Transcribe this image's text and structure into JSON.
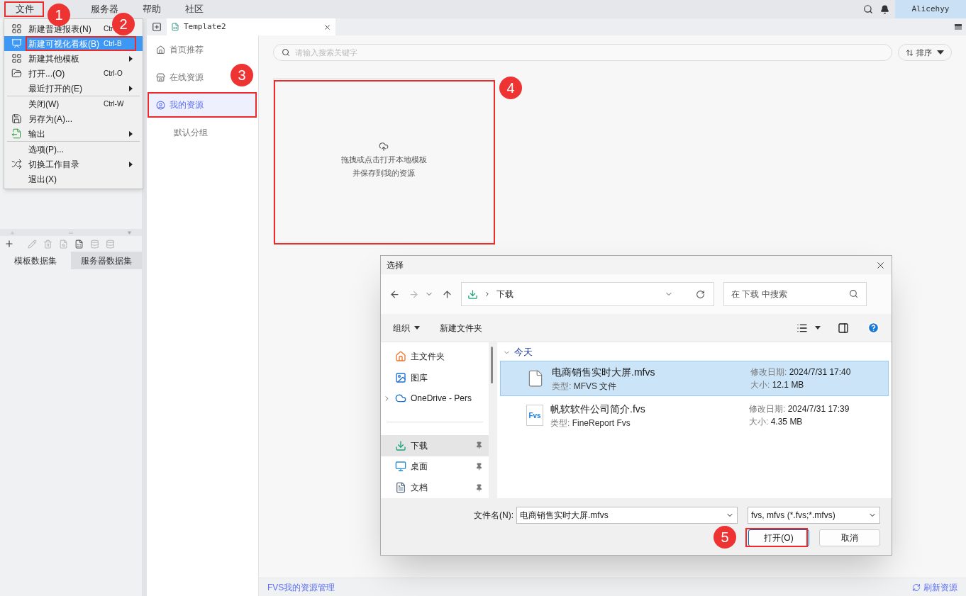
{
  "menubar": {
    "items": [
      {
        "label": "文件"
      },
      {
        "label": "服务器"
      },
      {
        "label": "帮助"
      },
      {
        "label": "社区"
      }
    ],
    "user": "Alicehyy"
  },
  "file_menu": {
    "items": [
      {
        "kind": "item",
        "label": "新建普通报表(N)",
        "shortcut": "Ctr",
        "selected": false,
        "submenu": false
      },
      {
        "kind": "item",
        "label": "新建可视化看板(B)",
        "shortcut": "Ctrl-B",
        "selected": true,
        "submenu": false
      },
      {
        "kind": "item",
        "label": "新建其他模板",
        "selected": false,
        "submenu": true
      },
      {
        "kind": "item",
        "label": "打开...(O)",
        "shortcut": "Ctrl-O",
        "selected": false,
        "submenu": false
      },
      {
        "kind": "item",
        "label": "最近打开的(E)",
        "selected": false,
        "submenu": true
      },
      {
        "kind": "separator"
      },
      {
        "kind": "item",
        "label": "关闭(W)",
        "shortcut": "Ctrl-W",
        "selected": false,
        "submenu": false
      },
      {
        "kind": "item",
        "label": "另存为(A)...",
        "selected": false,
        "submenu": false
      },
      {
        "kind": "item",
        "label": "输出",
        "selected": false,
        "submenu": true
      },
      {
        "kind": "separator"
      },
      {
        "kind": "item",
        "label": "选项(P)...",
        "selected": false,
        "submenu": false
      },
      {
        "kind": "item",
        "label": "切换工作目录",
        "selected": false,
        "submenu": true
      },
      {
        "kind": "item",
        "label": "退出(X)",
        "selected": false,
        "submenu": false
      }
    ]
  },
  "dataset_panel": {
    "tabs": [
      {
        "label": "模板数据集",
        "selected": true
      },
      {
        "label": "服务器数据集",
        "selected": false
      }
    ]
  },
  "editor_tabs": [
    {
      "label": "Template2",
      "selected": true
    }
  ],
  "resource_nav": [
    {
      "label": "首页推荐",
      "selected": false
    },
    {
      "label": "在线资源",
      "selected": false
    },
    {
      "label": "我的资源",
      "selected": true,
      "children": [
        {
          "label": "默认分组",
          "selected": false
        }
      ]
    }
  ],
  "search": {
    "placeholder": "请输入搜索关键字"
  },
  "sort": {
    "label": "排序"
  },
  "upload_card": {
    "lines": [
      "拖拽或点击打开本地模板",
      "并保存到我的资源"
    ]
  },
  "dialog": {
    "title": "选择",
    "address": "下载",
    "search_placeholder": "在 下载 中搜索",
    "toolbar": [
      "组织",
      "新建文件夹"
    ],
    "nav": [
      {
        "label": "主文件夹",
        "selected": false,
        "expandable": false,
        "pinned": false
      },
      {
        "label": "图库",
        "selected": false,
        "expandable": false,
        "pinned": false
      },
      {
        "label": "OneDrive - Pers",
        "selected": false,
        "expandable": true,
        "pinned": false
      },
      {
        "kind": "separator"
      },
      {
        "label": "下载",
        "selected": true,
        "expandable": false,
        "pinned": true
      },
      {
        "label": "桌面",
        "selected": false,
        "expandable": false,
        "pinned": true
      },
      {
        "label": "文档",
        "selected": false,
        "expandable": false,
        "pinned": true
      }
    ],
    "group": {
      "label": "今天",
      "expanded": true
    },
    "files": [
      {
        "name": "电商销售实时大屏.mfvs",
        "type_label": "类型:",
        "type": "MFVS 文件",
        "date_label": "修改日期:",
        "date": "2024/7/31 17:40",
        "size_label": "大小:",
        "size": "12.1 MB",
        "selected": true,
        "kind": "blank"
      },
      {
        "name": "帆软软件公司简介.fvs",
        "type_label": "类型:",
        "type": "FineReport Fvs",
        "date_label": "修改日期:",
        "date": "2024/7/31 17:39",
        "size_label": "大小:",
        "size": "4.35 MB",
        "selected": false,
        "kind": "fvs",
        "icon_text": "Fvs"
      }
    ],
    "filename_label": "文件名(N):",
    "filename": "电商销售实时大屏.mfvs",
    "filter": "fvs, mfvs (*.fvs;*.mfvs)",
    "buttons": [
      {
        "label": "打开(O)",
        "primary": true
      },
      {
        "label": "取消",
        "primary": false
      }
    ]
  },
  "footer": {
    "link": "FVS我的资源管理",
    "refresh": "刷新资源"
  },
  "annotations": [
    {
      "number": "1"
    },
    {
      "number": "2"
    },
    {
      "number": "3"
    },
    {
      "number": "4"
    },
    {
      "number": "5"
    }
  ]
}
